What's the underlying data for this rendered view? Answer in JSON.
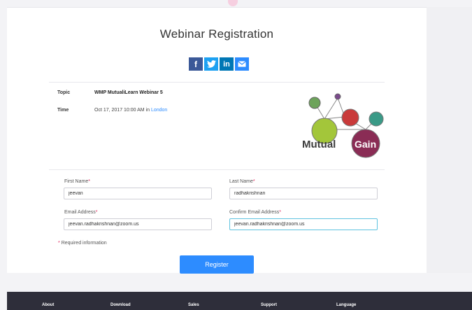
{
  "page": {
    "title": "Webinar Registration"
  },
  "share": {
    "facebook_icon": "f",
    "twitter_icon": "twitter-bird",
    "linkedin_icon": "in",
    "email_icon": "envelope"
  },
  "webinar": {
    "topic_label": "Topic",
    "topic_value": "WMP MutualiLearn Webinar 5",
    "time_label": "Time",
    "time_value": "Oct 17, 2017 10:00 AM in ",
    "time_zone": "London"
  },
  "logo": {
    "text_mutual": "Mutual",
    "text_gain": "Gain",
    "colors": {
      "green": "#a3c63a",
      "red": "#c93a3a",
      "teal": "#3a9a87",
      "purple": "#8a2c55",
      "small_green": "#6da35b",
      "small_purple": "#7b4a8c"
    }
  },
  "form": {
    "first_name_label": "First Name",
    "first_name_value": "jeevan",
    "last_name_label": "Last Name",
    "last_name_value": "radhakrishnan",
    "email_label": "Email Address",
    "email_value": "jeevan.radhakrishnan@zoom.us",
    "confirm_email_label": "Confirm Email Address",
    "confirm_email_value": "jeevan.radhakrishnan@zoom.us",
    "required_marker": "*",
    "required_note": "Required information",
    "register_label": "Register"
  },
  "footer": {
    "items": [
      "About",
      "Download",
      "Sales",
      "Support",
      "Language"
    ]
  },
  "colors": {
    "accent": "#2d8cff",
    "required": "#e0245e",
    "footer_bg": "#2e2e3a"
  }
}
